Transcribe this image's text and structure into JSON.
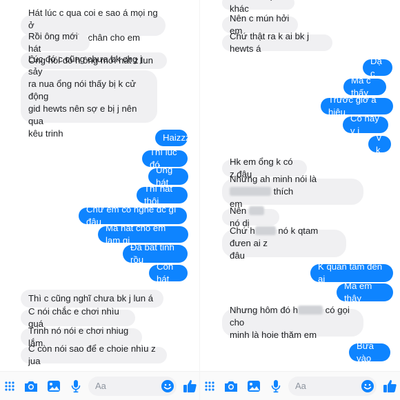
{
  "left": {
    "messages": [
      {
        "dir": "recv",
        "parts": [
          {
            "t": "Hát lúc c qua coi e sao á mọi ng ở\nđó coi em bóp chân cho em"
          }
        ]
      },
      {
        "dir": "recv",
        "parts": [
          {
            "t": "Rồi ông mới hát"
          }
        ]
      },
      {
        "dir": "recv",
        "parts": [
          {
            "t": "Ông nói đó h ông mới hát z lun"
          }
        ]
      },
      {
        "dir": "recv",
        "parts": [
          {
            "t": "Lúc đó c cũng chưa bk chg j sảy\nra nua ổng nói thấy bị k cử động\ngid hewts nên sợ e bị j nên qua\nkêu trinh"
          }
        ]
      },
      {
        "dir": "sent",
        "parts": [
          {
            "t": "Haizzz"
          }
        ]
      },
      {
        "dir": "sent",
        "parts": [
          {
            "t": "Thì lúc đó"
          }
        ]
      },
      {
        "dir": "sent",
        "parts": [
          {
            "t": "Ủng hát"
          }
        ]
      },
      {
        "dir": "sent",
        "parts": [
          {
            "t": "Thì hát thôi"
          }
        ]
      },
      {
        "dir": "sent",
        "parts": [
          {
            "t": "Chứ em có nghe đc gì đâu"
          }
        ]
      },
      {
        "dir": "sent",
        "parts": [
          {
            "t": "Ma hát cho em lam gi"
          }
        ]
      },
      {
        "dir": "sent",
        "parts": [
          {
            "t": "Đã bất tỉnh rồu"
          }
        ]
      },
      {
        "dir": "sent",
        "parts": [
          {
            "t": "Còn hát"
          }
        ]
      },
      {
        "dir": "recv",
        "parts": [
          {
            "t": "Thì c cũng nghĩ chưa bk j lun á"
          }
        ]
      },
      {
        "dir": "recv",
        "parts": [
          {
            "t": "C nói chắc e chơi nhìu quá"
          }
        ]
      },
      {
        "dir": "recv",
        "parts": [
          {
            "t": "Trinh nó nói e chơi nhiug lắm"
          }
        ]
      },
      {
        "dir": "recv",
        "parts": [
          {
            "t": "C còn nói sao để e choie nhìu z jua"
          }
        ]
      }
    ],
    "composer": {
      "placeholder": "Aa"
    }
  },
  "right": {
    "messages": [
      {
        "dir": "recv",
        "parts": [
          {
            "t": "Minh nói lại khác"
          }
        ]
      },
      {
        "dir": "recv",
        "parts": [
          {
            "t": "Nên c mún hởi em"
          }
        ]
      },
      {
        "dir": "recv",
        "parts": [
          {
            "t": "Chứ thật ra k ai bk j hewts á"
          }
        ]
      },
      {
        "dir": "sent",
        "parts": [
          {
            "t": "Dạ c"
          }
        ]
      },
      {
        "dir": "sent",
        "parts": [
          {
            "t": "Ma c thấy"
          }
        ]
      },
      {
        "dir": "sent",
        "parts": [
          {
            "t": "Trước giơ a hiêu"
          }
        ]
      },
      {
        "dir": "sent",
        "parts": [
          {
            "t": "Có hay v j"
          }
        ]
      },
      {
        "dir": "sent",
        "parts": [
          {
            "t": "V k"
          }
        ]
      },
      {
        "dir": "recv",
        "parts": [
          {
            "t": "Hk em ổng k có z đâu"
          }
        ]
      },
      {
        "dir": "recv",
        "parts": [
          {
            "t": "Nhưng ah minh nói là "
          },
          {
            "redact": 60
          },
          {
            "t": " thích\nem"
          }
        ]
      },
      {
        "dir": "recv",
        "parts": [
          {
            "t": "Nên "
          },
          {
            "redact": 22
          },
          {
            "t": " nó dị"
          }
        ]
      },
      {
        "dir": "recv",
        "parts": [
          {
            "t": "Chứ h"
          },
          {
            "redact": 30
          },
          {
            "t": " nó k qtam đưen ai z\nđâu"
          }
        ]
      },
      {
        "dir": "sent",
        "parts": [
          {
            "t": "K quan tâm đên ai"
          }
        ]
      },
      {
        "dir": "sent",
        "parts": [
          {
            "t": "Ma em thây"
          }
        ]
      },
      {
        "dir": "recv",
        "parts": [
          {
            "t": "Nhưng hôm đó h"
          },
          {
            "redact": 36
          },
          {
            "t": " có gọi cho\nminh là hoie thăm em"
          }
        ]
      },
      {
        "dir": "sent",
        "parts": [
          {
            "t": "Bữa vào"
          }
        ]
      }
    ],
    "composer": {
      "placeholder": "Aa"
    }
  },
  "colors": {
    "accent": "#0e84ff",
    "received_bg": "#f0f0f2"
  },
  "icons": [
    "apps-icon",
    "camera-icon",
    "photo-icon",
    "microphone-icon",
    "emoji-icon",
    "thumbs-up-icon"
  ]
}
